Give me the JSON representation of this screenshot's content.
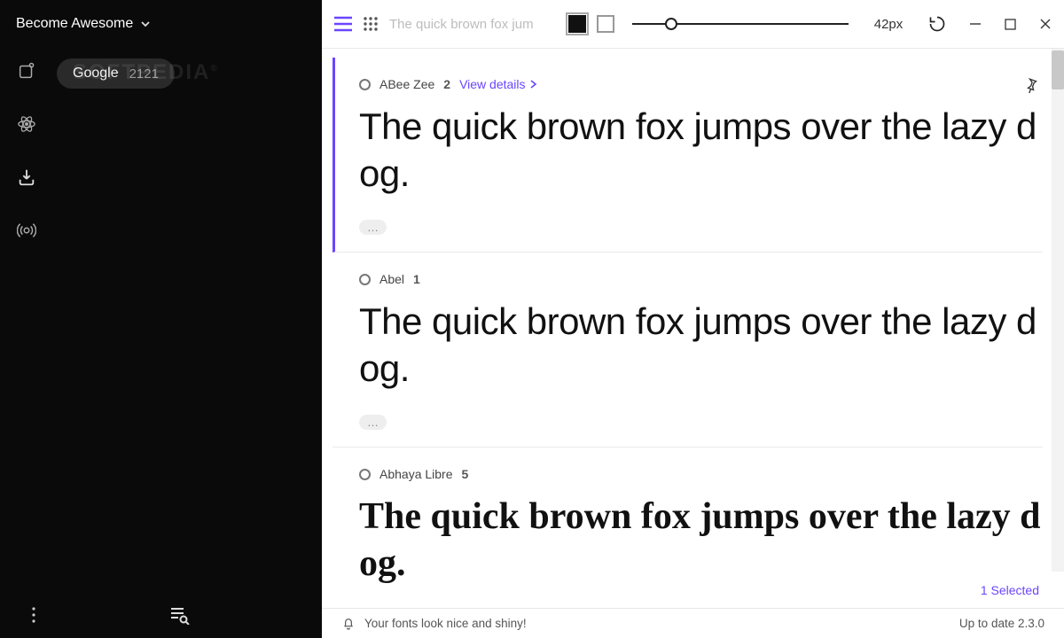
{
  "sidebar": {
    "title": "Become Awesome",
    "sources": [
      {
        "name": "Google",
        "count": "2121"
      }
    ],
    "watermark": "SOFTPEDIA"
  },
  "toolbar": {
    "preview_placeholder": "The quick brown fox jum",
    "size_label": "42px",
    "colors": {
      "fg": "#111111",
      "bg": "#ffffff"
    }
  },
  "window": {
    "minimize": "−",
    "maximize": "□",
    "close": "✕"
  },
  "fonts": [
    {
      "name": "ABee Zee",
      "count": "2",
      "details_label": "View details",
      "sample": "The quick brown fox jumps over the lazy dog.",
      "active": true,
      "pinned": true
    },
    {
      "name": "Abel",
      "count": "1",
      "sample": "The quick brown fox jumps over the lazy dog.",
      "active": false
    },
    {
      "name": "Abhaya Libre",
      "count": "5",
      "sample": "The quick brown fox jumps over the lazy dog.",
      "active": false
    }
  ],
  "selection": {
    "label": "1 Selected"
  },
  "status": {
    "message": "Your fonts look nice and shiny!",
    "version": "Up to date 2.3.0"
  }
}
